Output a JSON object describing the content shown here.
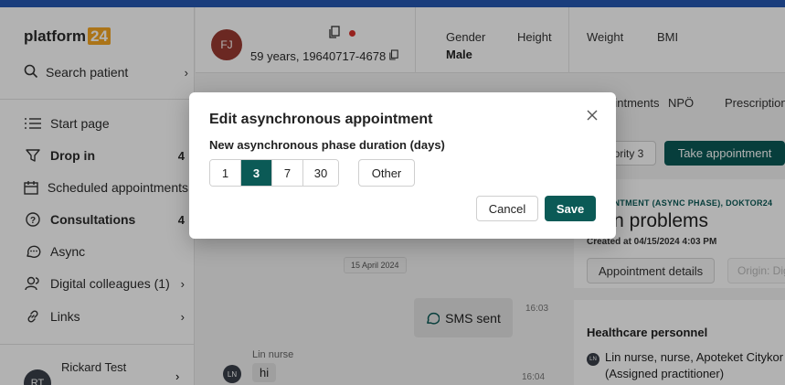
{
  "sidebar": {
    "logo_text": "platform",
    "logo_number": "24",
    "search_label": "Search patient",
    "items": [
      {
        "label": "Start page"
      },
      {
        "label": "Drop in",
        "count": "4"
      },
      {
        "label": "Scheduled appointments"
      },
      {
        "label": "Consultations",
        "count": "4"
      },
      {
        "label": "Async"
      },
      {
        "label": "Digital colleagues (1)"
      },
      {
        "label": "Links"
      }
    ],
    "user": {
      "initials": "RT",
      "name": "Rickard Test"
    }
  },
  "patient": {
    "initials": "FJ",
    "age_id": "59 years, 19640717-4678",
    "gender_label": "Gender",
    "gender_value": "Male",
    "height_label": "Height",
    "weight_label": "Weight",
    "bmi_label": "BMI"
  },
  "tabs": [
    "Appointments",
    "NPÖ",
    "Prescriptions"
  ],
  "chat": {
    "date_chip": "15 April 2024",
    "sms_label": "SMS sent",
    "sms_time": "16:03",
    "sender_name": "Lin nurse",
    "sender_initials": "LN",
    "message": "hi",
    "message_time": "16:04"
  },
  "right_panel": {
    "priority_select": "Priority 3",
    "take_button": "Take appointment",
    "kind": "APPOINTMENT (ASYNC PHASE), DOKTOR24",
    "title": "Skin problems",
    "created": "Created at 04/15/2024 4:03 PM",
    "details_button": "Appointment details",
    "origin_button": "Origin: Digital",
    "personnel_title": "Healthcare personnel",
    "personnel_initials": "LN",
    "personnel_line1": "Lin nurse, nurse, Apoteket Citykor",
    "personnel_line2": "(Assigned practitioner)"
  },
  "modal": {
    "title": "Edit asynchronous appointment",
    "label": "New asynchronous phase duration (days)",
    "options": [
      "1",
      "3",
      "7",
      "30"
    ],
    "selected": "3",
    "other_label": "Other",
    "cancel_label": "Cancel",
    "save_label": "Save"
  },
  "colors": {
    "accent": "#0b5a56",
    "brand": "#f5a623",
    "alert": "#d9312b"
  }
}
